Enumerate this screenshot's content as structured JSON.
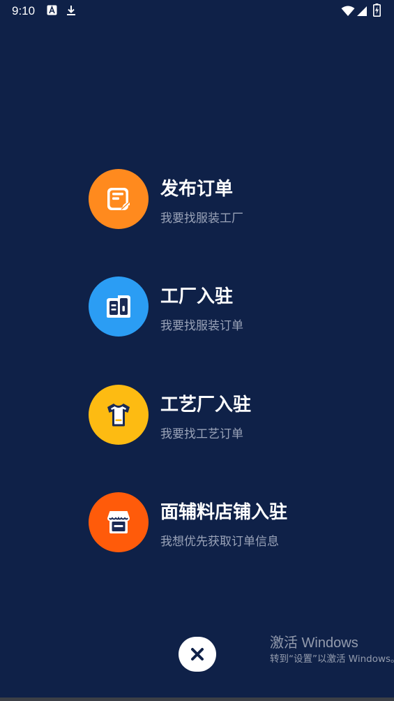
{
  "status_bar": {
    "time": "9:10",
    "icons": [
      "a-notification-icon",
      "download-icon",
      "wifi-icon",
      "signal-icon",
      "battery-charging-icon"
    ]
  },
  "menu": [
    {
      "title": "发布订单",
      "subtitle": "我要找服装工厂",
      "icon": "order-icon",
      "color": "#ff8a1e"
    },
    {
      "title": "工厂入驻",
      "subtitle": "我要找服装订单",
      "icon": "factory-icon",
      "color": "#2b9df4"
    },
    {
      "title": "工艺厂入驻",
      "subtitle": "我要找工艺订单",
      "icon": "tshirt-icon",
      "color": "#fdbb12"
    },
    {
      "title": "面辅料店铺入驻",
      "subtitle": "我想优先获取订单信息",
      "icon": "store-icon",
      "color": "#ff5b0a"
    }
  ],
  "close": {
    "icon": "close-icon"
  },
  "watermark": {
    "title": "激活 Windows",
    "subtitle": "转到“设置”以激活 Windows。"
  }
}
